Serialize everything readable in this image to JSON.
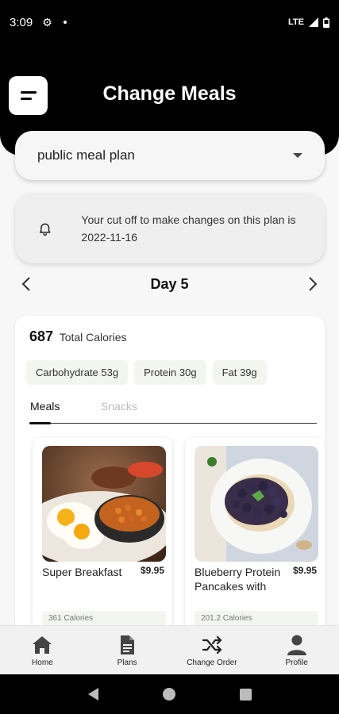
{
  "status_bar": {
    "time": "3:09",
    "network": "LTE"
  },
  "header": {
    "title": "Change Meals"
  },
  "meal_plan_select": {
    "value": "public meal plan"
  },
  "notice": {
    "text": "Your cut off to make changes on this plan is 2022-11-16"
  },
  "day_nav": {
    "label": "Day 5"
  },
  "summary": {
    "total_calories": "687",
    "total_calories_label": "Total Calories",
    "macros": [
      "Carbohydrate 53g",
      "Protein 30g",
      "Fat 39g"
    ]
  },
  "tabs": [
    "Meals",
    "Snacks"
  ],
  "meals": [
    {
      "name": "Super Breakfast",
      "price": "$9.95",
      "calories": "361 Calories"
    },
    {
      "name": "Blueberry Protein Pancakes with",
      "price": "$9.95",
      "calories": "201.2 Calories"
    }
  ],
  "bottom_nav": [
    "Home",
    "Plans",
    "Change Order",
    "Profile"
  ]
}
